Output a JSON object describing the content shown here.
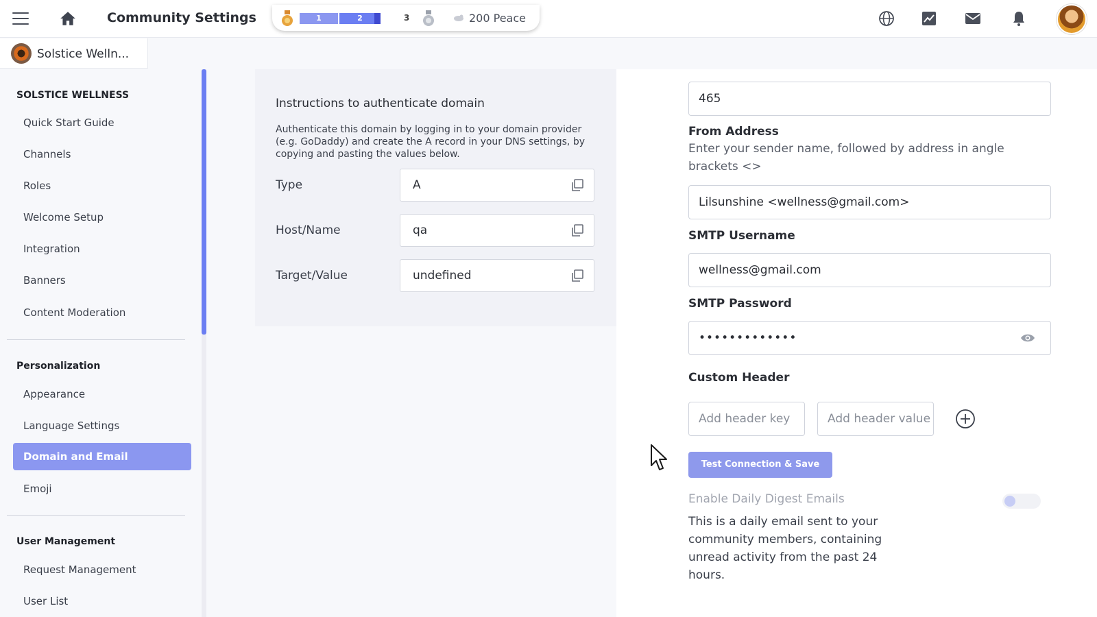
{
  "header": {
    "title": "Community Settings",
    "level_bar": {
      "seg1": "1",
      "seg2": "2",
      "next_level": "3",
      "progress": 0.5
    },
    "points": "200 Peace"
  },
  "community": {
    "name": "Solstice Welln..."
  },
  "sidebar": {
    "section1_title": "SOLSTICE WELLNESS",
    "section1_items": [
      "Quick Start Guide",
      "Channels",
      "Roles",
      "Welcome Setup",
      "Integration",
      "Banners",
      "Content Moderation"
    ],
    "section2_title": "Personalization",
    "section2_items": [
      "Appearance",
      "Language Settings"
    ],
    "active_item": "Domain and Email",
    "section2_items_after": [
      "Emoji"
    ],
    "section3_title": "User Management",
    "section3_items": [
      "Request Management",
      "User List"
    ]
  },
  "instructions": {
    "title": "Instructions to authenticate domain",
    "text": "Authenticate this domain by logging in to your domain provider (e.g. GoDaddy) and create the A record in your DNS settings, by copying and pasting the values below.",
    "type_label": "Type",
    "type_value": "A",
    "host_label": "Host/Name",
    "host_value": "qa",
    "target_label": "Target/Value",
    "target_value": "undefined"
  },
  "form": {
    "port_value": "465",
    "from_label": "From Address",
    "from_help": "Enter your sender name, followed by address in angle brackets <>",
    "from_value": "Lilsunshine <wellness@gmail.com>",
    "smtp_user_label": "SMTP Username",
    "smtp_user_value": "wellness@gmail.com",
    "smtp_pass_label": "SMTP Password",
    "smtp_pass_value": "•••••••••••••",
    "custom_header_label": "Custom Header",
    "header_key_placeholder": "Add header key",
    "header_value_placeholder": "Add header value",
    "test_button": "Test Connection & Save",
    "digest_label": "Enable Daily Digest Emails",
    "digest_enabled": false,
    "digest_desc": "This is a daily email sent to your community members, containing unread activity from the past 24 hours."
  },
  "colors": {
    "accent": "#8b97f0",
    "accent_dark": "#6b7ef2",
    "button": "#8e99ec"
  },
  "icons": [
    "menu-icon",
    "home-icon",
    "medal-icon",
    "peace-icon",
    "globe-icon",
    "chart-icon",
    "mail-icon",
    "bell-icon",
    "copy-icon",
    "eye-icon",
    "plus-circle-icon",
    "cursor-icon"
  ]
}
